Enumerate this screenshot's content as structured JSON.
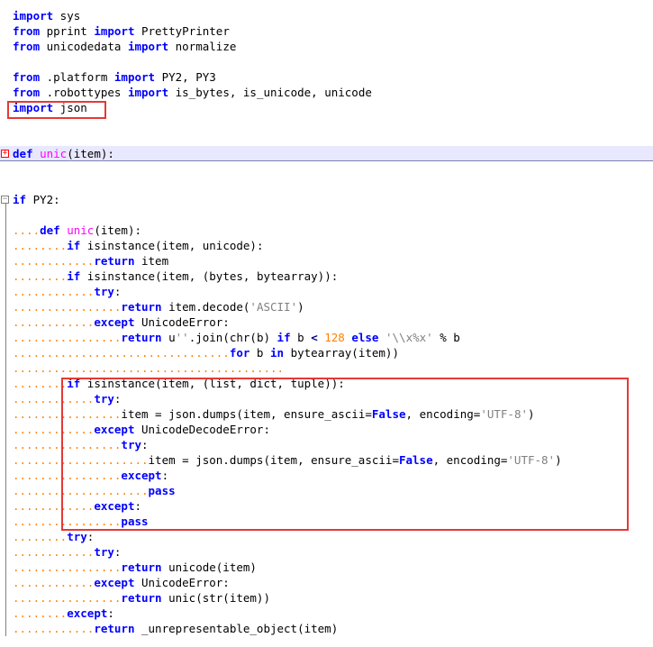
{
  "editor": {
    "language": "python",
    "lines": [
      [
        [
          "kw",
          "import"
        ],
        [
          "t",
          " sys"
        ]
      ],
      [
        [
          "kw",
          "from"
        ],
        [
          "t",
          " pprint "
        ],
        [
          "kw",
          "import"
        ],
        [
          "t",
          " PrettyPrinter"
        ]
      ],
      [
        [
          "kw",
          "from"
        ],
        [
          "t",
          " unicodedata "
        ],
        [
          "kw",
          "import"
        ],
        [
          "t",
          " normalize"
        ]
      ],
      [],
      [
        [
          "kw",
          "from"
        ],
        [
          "t",
          " .platform "
        ],
        [
          "kw",
          "import"
        ],
        [
          "t",
          " PY2, PY3"
        ]
      ],
      [
        [
          "kw",
          "from"
        ],
        [
          "t",
          " .robottypes "
        ],
        [
          "kw",
          "import"
        ],
        [
          "t",
          " is_bytes, is_unicode, unicode"
        ]
      ],
      [
        [
          "kw",
          "import"
        ],
        [
          "t",
          " json"
        ]
      ],
      [],
      [],
      [
        [
          "kw",
          "def"
        ],
        [
          "t",
          " "
        ],
        [
          "fn",
          "unic"
        ],
        [
          "t",
          "(item):"
        ]
      ],
      [],
      [],
      [
        [
          "kw",
          "if"
        ],
        [
          "t",
          " PY2:"
        ]
      ],
      [],
      [
        [
          "ws",
          "...."
        ],
        [
          "kw",
          "def"
        ],
        [
          "t",
          " "
        ],
        [
          "fn",
          "unic"
        ],
        [
          "t",
          "(item):"
        ]
      ],
      [
        [
          "ws",
          "........"
        ],
        [
          "kw",
          "if"
        ],
        [
          "t",
          " isinstance(item, unicode):"
        ]
      ],
      [
        [
          "ws",
          "............"
        ],
        [
          "kw",
          "return"
        ],
        [
          "t",
          " item"
        ]
      ],
      [
        [
          "ws",
          "........"
        ],
        [
          "kw",
          "if"
        ],
        [
          "t",
          " isinstance(item, (bytes, bytearray)):"
        ]
      ],
      [
        [
          "ws",
          "............"
        ],
        [
          "kw",
          "try"
        ],
        [
          "t",
          ":"
        ]
      ],
      [
        [
          "ws",
          "................"
        ],
        [
          "kw",
          "return"
        ],
        [
          "t",
          " item.decode("
        ],
        [
          "str",
          "'ASCII'"
        ],
        [
          "t",
          ")"
        ]
      ],
      [
        [
          "ws",
          "............"
        ],
        [
          "kw",
          "except"
        ],
        [
          "t",
          " UnicodeError:"
        ]
      ],
      [
        [
          "ws",
          "................"
        ],
        [
          "kw",
          "return"
        ],
        [
          "t",
          " u"
        ],
        [
          "str",
          "''"
        ],
        [
          "t",
          ".join(chr(b) "
        ],
        [
          "kw",
          "if"
        ],
        [
          "t",
          " b "
        ],
        [
          "op",
          "<"
        ],
        [
          "t",
          " "
        ],
        [
          "num",
          "128"
        ],
        [
          "t",
          " "
        ],
        [
          "kw",
          "else"
        ],
        [
          "t",
          " "
        ],
        [
          "str",
          "'\\\\x%x'"
        ],
        [
          "t",
          " % b"
        ]
      ],
      [
        [
          "ws",
          "................................"
        ],
        [
          "kw",
          "for"
        ],
        [
          "t",
          " b "
        ],
        [
          "kw",
          "in"
        ],
        [
          "t",
          " bytearray(item))"
        ]
      ],
      [
        [
          "ws",
          "........................................"
        ]
      ],
      [
        [
          "ws",
          "........"
        ],
        [
          "kw",
          "if"
        ],
        [
          "t",
          " isinstance(item, (list, dict, tuple)):"
        ]
      ],
      [
        [
          "ws",
          "............"
        ],
        [
          "kw",
          "try"
        ],
        [
          "t",
          ":"
        ]
      ],
      [
        [
          "ws",
          "................"
        ],
        [
          "t",
          "item = json.dumps(item, ensure_ascii="
        ],
        [
          "kw",
          "False"
        ],
        [
          "t",
          ", encoding="
        ],
        [
          "str",
          "'UTF-8'"
        ],
        [
          "t",
          ")"
        ]
      ],
      [
        [
          "ws",
          "............"
        ],
        [
          "kw",
          "except"
        ],
        [
          "t",
          " UnicodeDecodeError:"
        ]
      ],
      [
        [
          "ws",
          "................"
        ],
        [
          "kw",
          "try"
        ],
        [
          "t",
          ":"
        ]
      ],
      [
        [
          "ws",
          "...................."
        ],
        [
          "t",
          "item = json.dumps(item, ensure_ascii="
        ],
        [
          "kw",
          "False"
        ],
        [
          "t",
          ", encoding="
        ],
        [
          "str",
          "'UTF-8'"
        ],
        [
          "t",
          ")"
        ]
      ],
      [
        [
          "ws",
          "................"
        ],
        [
          "kw",
          "except"
        ],
        [
          "t",
          ":"
        ]
      ],
      [
        [
          "ws",
          "...................."
        ],
        [
          "kw",
          "pass"
        ]
      ],
      [
        [
          "ws",
          "............"
        ],
        [
          "kw",
          "except"
        ],
        [
          "t",
          ":"
        ]
      ],
      [
        [
          "ws",
          "................"
        ],
        [
          "kw",
          "pass"
        ]
      ],
      [
        [
          "ws",
          "........"
        ],
        [
          "kw",
          "try"
        ],
        [
          "t",
          ":"
        ]
      ],
      [
        [
          "ws",
          "............"
        ],
        [
          "kw",
          "try"
        ],
        [
          "t",
          ":"
        ]
      ],
      [
        [
          "ws",
          "................"
        ],
        [
          "kw",
          "return"
        ],
        [
          "t",
          " unicode(item)"
        ]
      ],
      [
        [
          "ws",
          "............"
        ],
        [
          "kw",
          "except"
        ],
        [
          "t",
          " UnicodeError:"
        ]
      ],
      [
        [
          "ws",
          "................"
        ],
        [
          "kw",
          "return"
        ],
        [
          "t",
          " unic(str(item))"
        ]
      ],
      [
        [
          "ws",
          "........"
        ],
        [
          "kw",
          "except"
        ],
        [
          "t",
          ":"
        ]
      ],
      [
        [
          "ws",
          "............"
        ],
        [
          "kw",
          "return"
        ],
        [
          "t",
          " _unrepresentable_object(item)"
        ]
      ]
    ]
  }
}
